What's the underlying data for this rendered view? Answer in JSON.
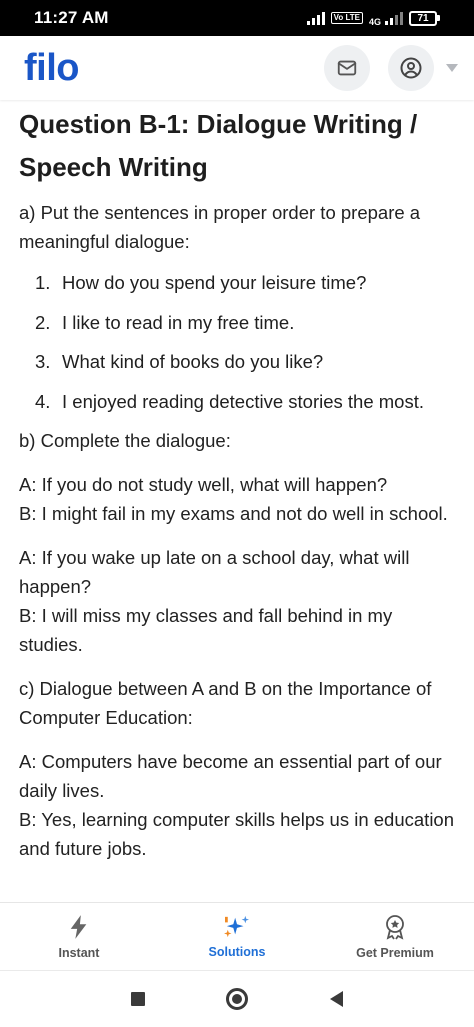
{
  "status_bar": {
    "time": "11:27 AM",
    "volte": "Vo LTE",
    "network": "4G",
    "battery": "71"
  },
  "header": {
    "logo": "filo",
    "mail_icon": "mail-icon",
    "profile_icon": "user-circle-icon"
  },
  "content": {
    "title": "Question B-1: Dialogue Writing / Speech Writing",
    "section_a": {
      "heading": "a) Put the sentences in proper order to prepare a meaningful dialogue:",
      "items": [
        {
          "num": "1.",
          "text": "How do you spend your leisure time?"
        },
        {
          "num": "2.",
          "text": "I like to read in my free time."
        },
        {
          "num": "3.",
          "text": "What kind of books do you like?"
        },
        {
          "num": "4.",
          "text": "I enjoyed reading detective stories the most."
        }
      ]
    },
    "section_b": {
      "heading": "b) Complete the dialogue:",
      "exchanges": [
        {
          "a": "A: If you do not study well, what will happen?",
          "b": "B: I might fail in my exams and not do well in school."
        },
        {
          "a": "A: If you wake up late on a school day, what will happen?",
          "b": "B: I will miss my classes and fall behind in my studies."
        }
      ]
    },
    "section_c": {
      "heading": "c) Dialogue between A and B on the Importance of Computer Education:",
      "exchange": {
        "a": "A: Computers have become an essential part of our daily lives.",
        "b": "B: Yes, learning computer skills helps us in education and future jobs."
      }
    }
  },
  "bottom_nav": {
    "items": [
      {
        "label": "Instant",
        "icon": "lightning-icon"
      },
      {
        "label": "Solutions",
        "icon": "sparkles-icon"
      },
      {
        "label": "Get Premium",
        "icon": "award-badge-icon"
      }
    ],
    "active_color": "#1f6fd6"
  },
  "colors": {
    "brand": "#1a56c7",
    "accent": "#1f6fd6"
  }
}
